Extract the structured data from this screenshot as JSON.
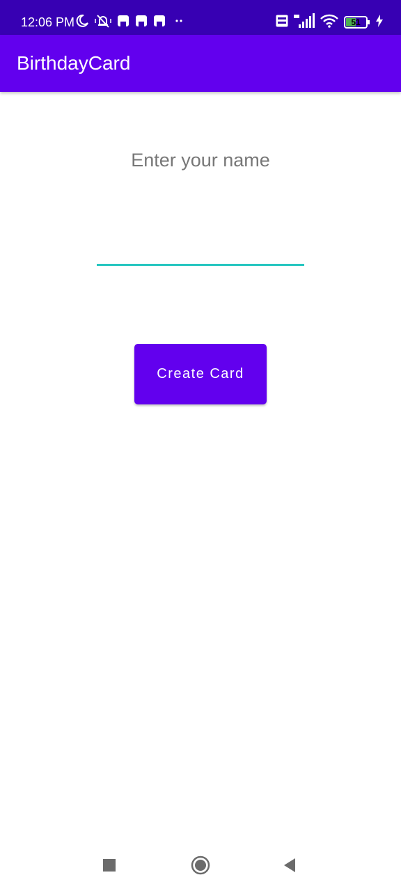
{
  "status_bar": {
    "time": "12:06 PM",
    "battery_level": "51",
    "background_color": "#3700b3",
    "icons": [
      "moon-icon",
      "notifications-muted-icon",
      "app-notification-icon",
      "app-notification-icon",
      "app-notification-icon",
      "more-dots-icon",
      "volte-icon",
      "signal-4g-icon",
      "wifi-icon",
      "battery-icon",
      "charging-icon"
    ]
  },
  "app_bar": {
    "title": "BirthdayCard",
    "background_color": "#6200ee"
  },
  "form": {
    "name_input": {
      "placeholder": "Enter your name",
      "value": "",
      "underline_color": "#26c6c0"
    },
    "create_button": {
      "label": "Create Card",
      "background_color": "#6200ee"
    }
  },
  "nav_bar": {
    "icons": [
      "recent-apps-icon",
      "home-icon",
      "back-icon"
    ]
  }
}
